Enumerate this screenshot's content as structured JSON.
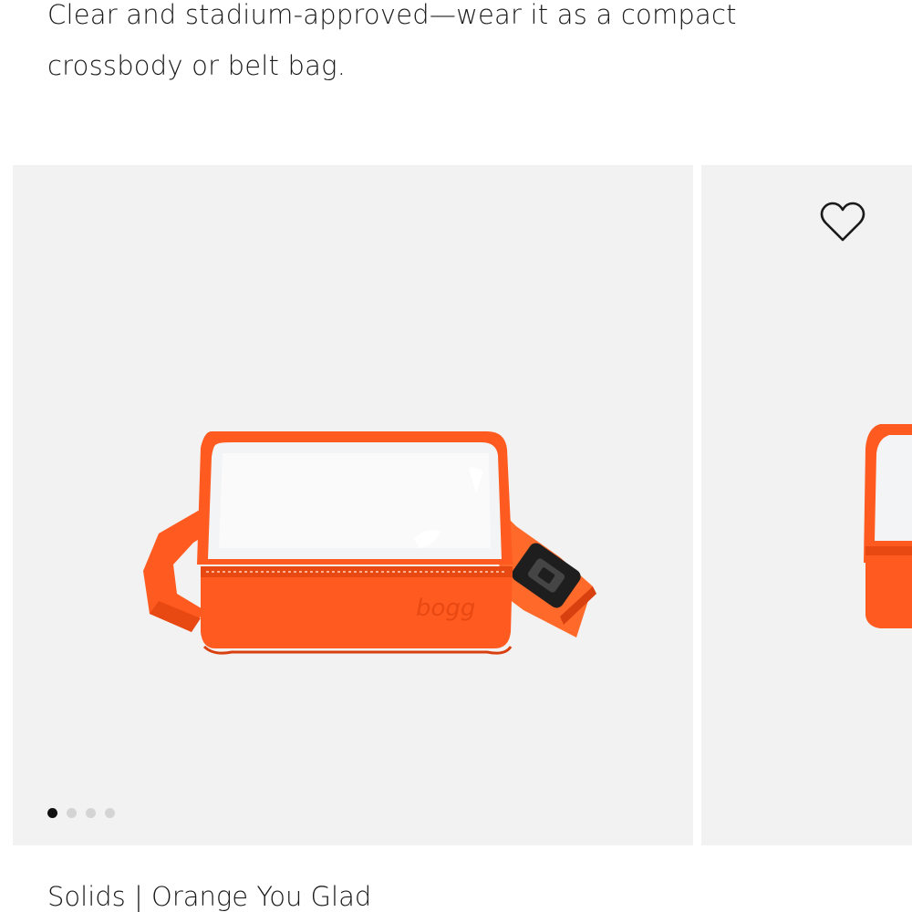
{
  "description": "Clear and stadium-approved—wear it as a compact crossbody or belt bag.",
  "product": {
    "title": "Solids | Orange You Glad",
    "brand_mark": "bogg",
    "color": "#ff5a1f"
  },
  "carousel": {
    "slide_count": 4,
    "active_index": 0
  },
  "icons": {
    "wishlist": "heart-outline-icon"
  }
}
